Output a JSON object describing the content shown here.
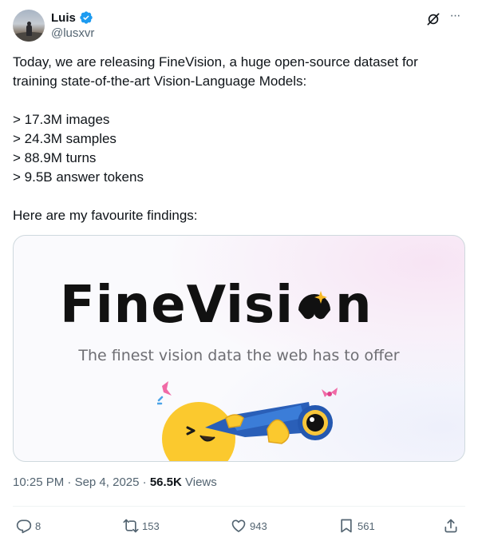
{
  "author": {
    "name": "Luis",
    "handle": "@lusxvr",
    "verified": true
  },
  "header_icons": {
    "grok": "grok-icon",
    "more": "···"
  },
  "tweet": {
    "intro": "Today, we are releasing FineVision, a huge open-source dataset for training state-of-the-art Vision-Language Models:",
    "bullets": [
      "> 17.3M images",
      "> 24.3M samples",
      "> 88.9M turns",
      "> 9.5B answer tokens"
    ],
    "closing": "Here are my favourite findings:"
  },
  "media": {
    "title_main": "FineVisi",
    "title_end": "n",
    "subtitle": "The finest vision data the web has to offer"
  },
  "meta": {
    "time": "10:25 PM",
    "separator": "·",
    "date": "Sep 4, 2025",
    "views_count": "56.5K",
    "views_label": "Views"
  },
  "actions": {
    "replies": "8",
    "reposts": "153",
    "likes": "943",
    "bookmarks": "561"
  },
  "colors": {
    "text": "#0f1419",
    "secondary": "#536471",
    "verified": "#1d9bf0",
    "border": "#cfd9de"
  }
}
